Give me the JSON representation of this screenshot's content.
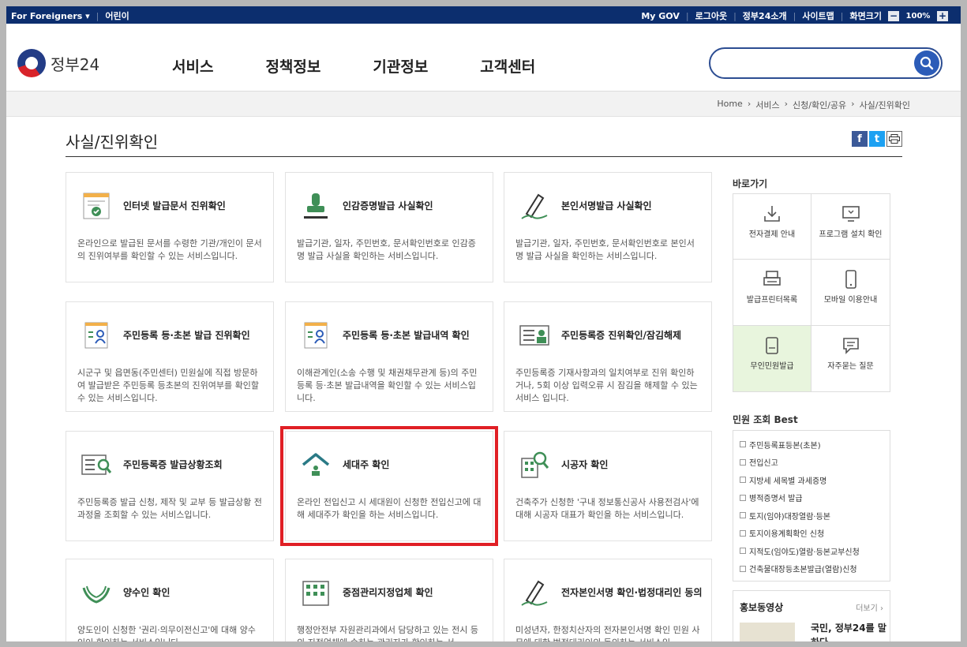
{
  "topbar": {
    "foreigners": "For Foreigners ▾",
    "kids": "어린이",
    "mygov": "My GOV",
    "logout": "로그아웃",
    "about": "정부24소개",
    "sitemap": "사이트맵",
    "screensize": "화면크기",
    "zoom_minus": "−",
    "zoom_value": "100%",
    "zoom_plus": "+"
  },
  "header": {
    "logo_text": "정부24",
    "nav": [
      "서비스",
      "정책정보",
      "기관정보",
      "고객센터"
    ],
    "search_placeholder": ""
  },
  "breadcrumb": [
    "Home",
    "서비스",
    "신청/확인/공유",
    "사실/진위확인"
  ],
  "breadcrumb_sep": "›",
  "page_title": "사실/진위확인",
  "cards": [
    {
      "title": "인터넷 발급문서 진위확인",
      "desc": "온라인으로 발급된 문서를 수령한 기관/개인이 문서의 진위여부를 확인할 수 있는 서비스입니다."
    },
    {
      "title": "인감증명발급 사실확인",
      "desc": "발급기관, 일자, 주민번호, 문서확인번호로 인감증명 발급 사실을 확인하는 서비스입니다."
    },
    {
      "title": "본인서명발급 사실확인",
      "desc": "발급기관, 일자, 주민번호, 문서확인번호로 본인서명 발급 사실을 확인하는 서비스입니다."
    },
    {
      "title": "주민등록 등·초본 발급 진위확인",
      "desc": "시군구 및 읍면동(주민센터) 민원실에 직접 방문하여 발급받은 주민등록 등초본의 진위여부를 확인할 수 있는 서비스입니다."
    },
    {
      "title": "주민등록 등·초본 발급내역 확인",
      "desc": "이해관계인(소송 수행 및 채권채무관계 등)의 주민등록 등·초본 발급내역을 확인할 수 있는 서비스입니다."
    },
    {
      "title": "주민등록증 진위확인/잠김해제",
      "desc": "주민등록증 기재사항과의 일치여부로 진위 확인하거나, 5회 이상 입력오류 시 잠김을 해제할 수 있는 서비스 입니다."
    },
    {
      "title": "주민등록증 발급상황조회",
      "desc": "주민등록증 발급 신청, 제작 및 교부 등 발급상황 전 과정을 조회할 수 있는 서비스입니다."
    },
    {
      "title": "세대주 확인",
      "desc": "온라인 전입신고 시 세대원이 신청한 전입신고에 대해 세대주가 확인을 하는 서비스입니다."
    },
    {
      "title": "시공자 확인",
      "desc": "건축주가 신청한 '구내 정보통신공사 사용전검사'에 대해 시공자 대표가 확인을 하는 서비스입니다."
    },
    {
      "title": "양수인 확인",
      "desc": "양도인이 신청한 '권리·의무이전신고'에 대해 양수인이 확인하는 서비스입니다."
    },
    {
      "title": "중점관리지정업체 확인",
      "desc": "행정안전부 자원관리과에서 담당하고 있는 전시 등의 지정업체에 속하는 관리자가 확인하는 서"
    },
    {
      "title": "전자본인서명 확인·법정대리인 동의",
      "desc": "미성년자, 한정치산자의 전자본인서명 확인 민원 사무에 대한 법정대리인의 동의하는 서비스입"
    }
  ],
  "side": {
    "quick_title": "바로가기",
    "quick": [
      "전자결제 안내",
      "프로그램 설치 확인",
      "발급프린터목록",
      "모바일 이용안내",
      "무인민원발급",
      "자주묻는 질문"
    ],
    "best_title": "민원 조회 Best",
    "best": [
      "주민등록표등본(초본)",
      "전입신고",
      "지방세 세목별 과세증명",
      "병적증명서 발급",
      "토지(임야)대장열람·등본",
      "토지이용계획확인 신청",
      "지적도(임야도)열람·등본교부신청",
      "건축물대장등초본발급(열람)신청"
    ],
    "promo_title": "홍보동영상",
    "promo_more": "더보기 ›",
    "promo_headline": "국민, 정부24를 말하다"
  },
  "colors": {
    "navy": "#0c2e6e",
    "accent_red": "#e01f25",
    "icon_green": "#3f8f57"
  }
}
